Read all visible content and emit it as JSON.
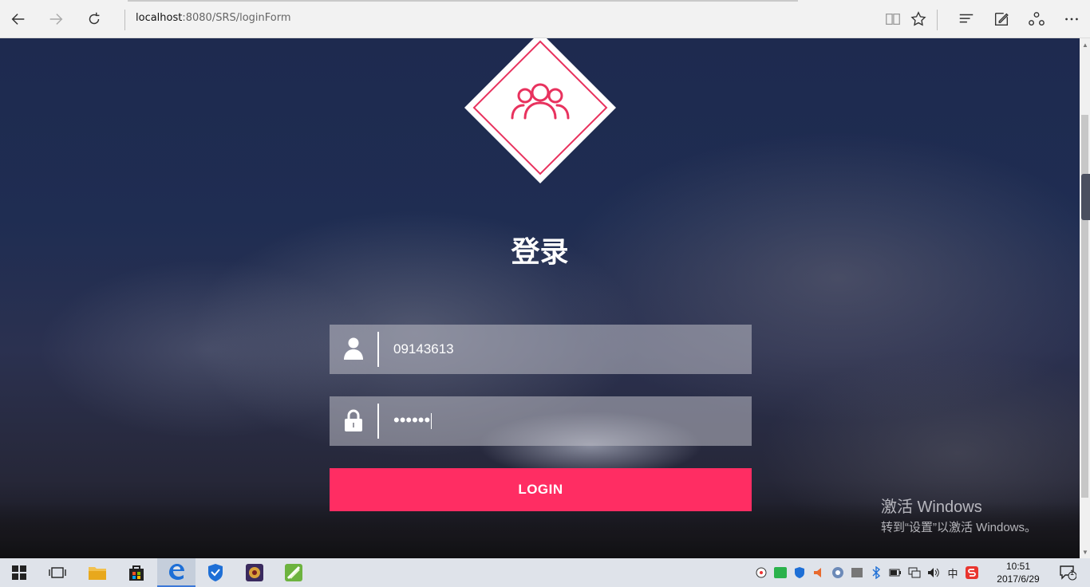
{
  "browser": {
    "url_host": "localhost",
    "url_rest": ":8080/SRS/loginForm",
    "icons": [
      "back-icon",
      "forward-icon",
      "refresh-icon",
      "reading-view-icon",
      "favorite-star-icon",
      "hub-icon",
      "web-note-icon",
      "share-icon",
      "more-icon"
    ]
  },
  "login": {
    "title": "登录",
    "username_value": "09143613",
    "password_mask": "••••••",
    "button_label": "LOGIN"
  },
  "watermark": {
    "line1": "激活 Windows",
    "line2": "转到“设置”以激活 Windows。"
  },
  "taskbar": {
    "ime": "中",
    "time": "10:51",
    "date": "2017/6/29",
    "notification_count": "1"
  },
  "colors": {
    "accent": "#ff2d63",
    "logo_stroke": "#e8325e"
  }
}
